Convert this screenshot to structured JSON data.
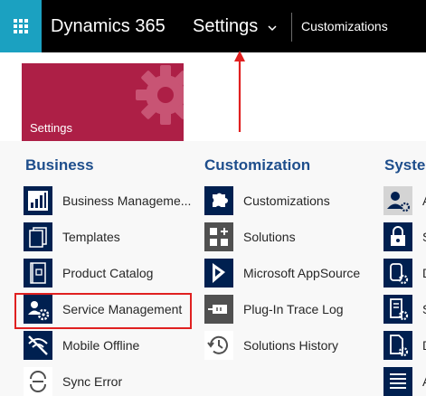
{
  "topbar": {
    "app_name": "Dynamics 365",
    "area_label": "Settings",
    "breadcrumb": "Customizations",
    "icons": [
      "app-launcher-icon",
      "chevron-down-icon"
    ]
  },
  "tile": {
    "label": "Settings",
    "color": "#ad1f46",
    "icon": "gear-icon"
  },
  "colors": {
    "nav_background": "#000000",
    "app_launcher": "#1ba1c1",
    "section_title": "#1e4e8c",
    "item_icon_blue": "#002050",
    "item_icon_gray": "#505050",
    "annotation_red": "#e02020"
  },
  "sections": {
    "business": {
      "title": "Business",
      "items": [
        {
          "label": "Business Manageme...",
          "icon": "business-management-icon"
        },
        {
          "label": "Templates",
          "icon": "templates-icon"
        },
        {
          "label": "Product Catalog",
          "icon": "product-catalog-icon"
        },
        {
          "label": "Service Management",
          "icon": "service-management-icon"
        },
        {
          "label": "Mobile Offline",
          "icon": "mobile-offline-icon"
        },
        {
          "label": "Sync Error",
          "icon": "sync-error-icon"
        }
      ]
    },
    "customization": {
      "title": "Customization",
      "items": [
        {
          "label": "Customizations",
          "icon": "puzzle-icon"
        },
        {
          "label": "Solutions",
          "icon": "solutions-icon"
        },
        {
          "label": "Microsoft AppSource",
          "icon": "appsource-icon"
        },
        {
          "label": "Plug-In Trace Log",
          "icon": "plugin-trace-log-icon"
        },
        {
          "label": "Solutions History",
          "icon": "history-icon"
        }
      ]
    },
    "system": {
      "title": "System",
      "items": [
        {
          "label": "A",
          "icon": "administration-icon"
        },
        {
          "label": "S",
          "icon": "security-lock-icon"
        },
        {
          "label": "D",
          "icon": "data-management-icon"
        },
        {
          "label": "S",
          "icon": "system-jobs-icon"
        },
        {
          "label": "D",
          "icon": "document-management-icon"
        },
        {
          "label": "A",
          "icon": "auditing-icon"
        }
      ]
    }
  }
}
